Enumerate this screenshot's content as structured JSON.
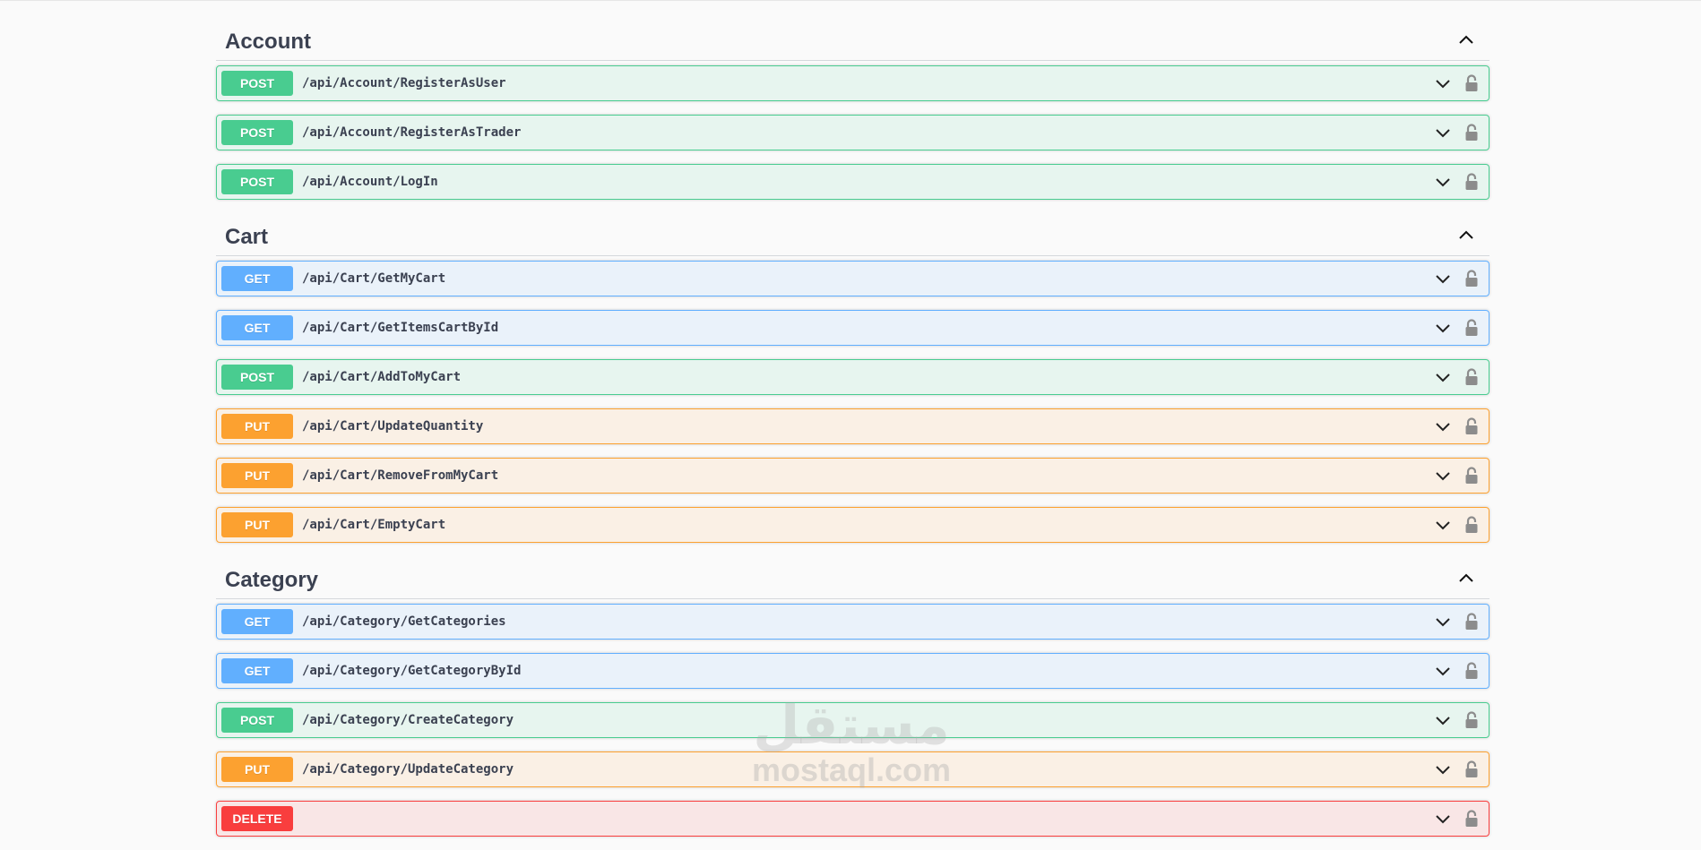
{
  "sections": [
    {
      "title": "Account",
      "operations": [
        {
          "method": "POST",
          "path": "/api/Account/RegisterAsUser"
        },
        {
          "method": "POST",
          "path": "/api/Account/RegisterAsTrader"
        },
        {
          "method": "POST",
          "path": "/api/Account/LogIn"
        }
      ]
    },
    {
      "title": "Cart",
      "operations": [
        {
          "method": "GET",
          "path": "/api/Cart/GetMyCart"
        },
        {
          "method": "GET",
          "path": "/api/Cart/GetItemsCartById"
        },
        {
          "method": "POST",
          "path": "/api/Cart/AddToMyCart"
        },
        {
          "method": "PUT",
          "path": "/api/Cart/UpdateQuantity"
        },
        {
          "method": "PUT",
          "path": "/api/Cart/RemoveFromMyCart"
        },
        {
          "method": "PUT",
          "path": "/api/Cart/EmptyCart"
        }
      ]
    },
    {
      "title": "Category",
      "operations": [
        {
          "method": "GET",
          "path": "/api/Category/GetCategories"
        },
        {
          "method": "GET",
          "path": "/api/Category/GetCategoryById"
        },
        {
          "method": "POST",
          "path": "/api/Category/CreateCategory"
        },
        {
          "method": "PUT",
          "path": "/api/Category/UpdateCategory"
        },
        {
          "method": "DELETE",
          "path": ""
        }
      ]
    }
  ],
  "watermark": {
    "arabic": "مستقل",
    "latin": "mostaql.com"
  },
  "icons": {
    "section_toggle": "chevron-up-icon",
    "operation_toggle": "chevron-down-icon",
    "auth": "lock-icon"
  },
  "colors": {
    "get": "#61affe",
    "post": "#49cc90",
    "put": "#fca130",
    "delete": "#f93e3e",
    "text": "#3b4151"
  }
}
